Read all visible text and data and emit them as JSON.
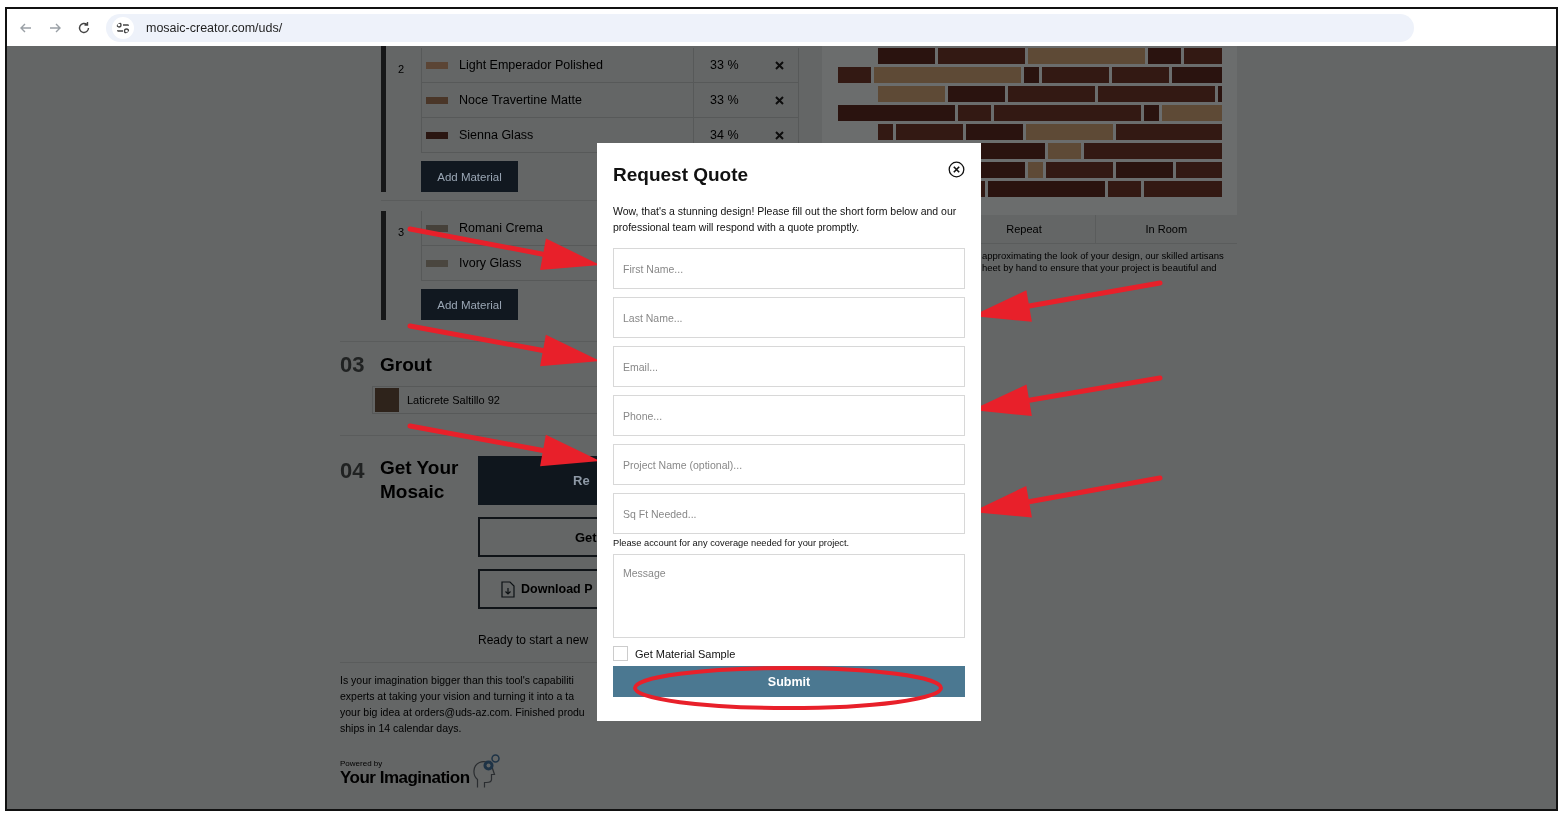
{
  "browser": {
    "url": "mosaic-creator.com/uds/"
  },
  "material_groups": [
    {
      "number": "2",
      "add_button": "Add Material",
      "items": [
        {
          "name": "Light Emperador Polished",
          "color": "#5b4535",
          "percent": "33 %"
        },
        {
          "name": "Noce Travertine Matte",
          "color": "#4a3628",
          "percent": "33 %"
        },
        {
          "name": "Sienna Glass",
          "color": "#2a1611",
          "percent": "34 %"
        }
      ]
    },
    {
      "number": "3",
      "add_button": "Add Material",
      "items": [
        {
          "name": "Romani Crema",
          "color": "#46413a"
        },
        {
          "name": "Ivory Glass",
          "color": "#4a463f"
        }
      ]
    }
  ],
  "grout": {
    "number": "03",
    "title": "Grout",
    "item": {
      "name": "Laticrete Saltillo 92",
      "color": "#2e231b"
    }
  },
  "get_mosaic": {
    "number": "04",
    "title": "Get Your Mosaic",
    "buttons": [
      {
        "kind": "filled",
        "label": "Re"
      },
      {
        "kind": "outline",
        "label": "Get"
      },
      {
        "kind": "download",
        "label": "Download P"
      }
    ],
    "note": "Ready to start a new"
  },
  "footer_text": [
    "Is your imagination bigger than this tool's capabiliti",
    "experts at taking your vision and turning it into a ta",
    "your big idea at orders@uds-az.com. Finished produ",
    "ships in 14 calendar days."
  ],
  "powered_by": {
    "caption": "Powered by",
    "name": "Your Imagination"
  },
  "preview": {
    "view_tabs": [
      "Repeat",
      "In Room"
    ],
    "description": [
      "approximating the look of your design, our skilled artisans",
      "heet by hand to ensure that your project is beautiful and"
    ]
  },
  "modal": {
    "title": "Request Quote",
    "intro": "Wow, that's a stunning design! Please fill out the short form below and our professional team will respond with a quote promptly.",
    "fields": [
      {
        "placeholder": "First Name..."
      },
      {
        "placeholder": "Last Name..."
      },
      {
        "placeholder": "Email..."
      },
      {
        "placeholder": "Phone..."
      },
      {
        "placeholder": "Project Name (optional)..."
      },
      {
        "placeholder": "Sq Ft Needed..."
      }
    ],
    "hint": "Please account for any coverage needed for your project.",
    "message": {
      "placeholder": "Message"
    },
    "sample_checkbox": {
      "label": "Get Material Sample",
      "checked": false
    },
    "submit": "Submit"
  }
}
